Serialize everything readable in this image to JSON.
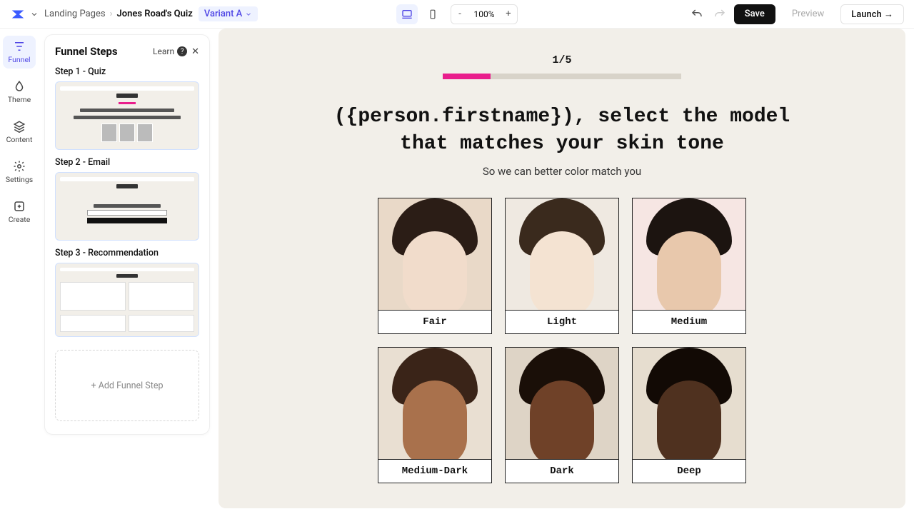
{
  "breadcrumbs": {
    "a": "Landing Pages",
    "b": "Jones Road's Quiz",
    "variant": "Variant A"
  },
  "zoom": "100%",
  "actions": {
    "save": "Save",
    "preview": "Preview",
    "launch": "Launch →"
  },
  "rail": {
    "funnel": "Funnel",
    "theme": "Theme",
    "content": "Content",
    "settings": "Settings",
    "create": "Create"
  },
  "panel": {
    "title": "Funnel Steps",
    "learn": "Learn",
    "steps": [
      {
        "label": "Step 1 - Quiz"
      },
      {
        "label": "Step 2 - Email"
      },
      {
        "label": "Step 3 - Recommendation"
      }
    ],
    "add": "+ Add Funnel Step"
  },
  "quiz": {
    "progress": "1/5",
    "headline": "({person.firstname}), select the model that matches your skin tone",
    "sub": "So we can better color match you",
    "options": [
      "Fair",
      "Light",
      "Medium",
      "Medium-Dark",
      "Dark",
      "Deep"
    ]
  }
}
